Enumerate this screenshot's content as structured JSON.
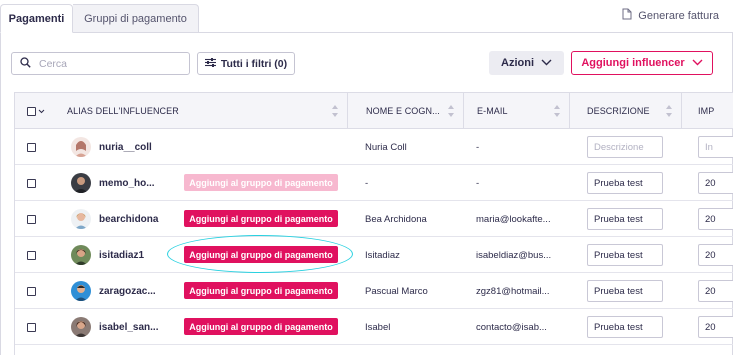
{
  "tabs": [
    {
      "label": "Pagamenti",
      "active": true
    },
    {
      "label": "Gruppi di pagamento",
      "active": false
    }
  ],
  "header_action": {
    "label": "Generare fattura",
    "icon": "document-icon"
  },
  "toolbar": {
    "search_placeholder": "Cerca",
    "search_icon": "search-icon",
    "filters_label": "Tutti i filtri (0)",
    "filters_icon": "sliders-icon",
    "actions_label": "Azioni",
    "add_influencer_label": "Aggiungi influencer"
  },
  "table": {
    "columns": [
      {
        "label": "ALIAS DELL'INFLUENCER"
      },
      {
        "label": "NOME E COGN..."
      },
      {
        "label": "E-MAIL"
      },
      {
        "label": "DESCRIZIONE"
      },
      {
        "label": "IMP"
      }
    ],
    "rows": [
      {
        "alias": "nuria__coll",
        "group_button": "",
        "name": "Nuria Coll",
        "email": "-",
        "description": "Descrizione",
        "description_is_placeholder": true,
        "amount": "In",
        "amount_is_placeholder": true
      },
      {
        "alias": "memo_ho...",
        "group_button": "Aggiungi al gruppo di pagamento",
        "group_button_disabled": true,
        "name": "-",
        "email": "-",
        "description": "Prueba test",
        "description_is_placeholder": false,
        "amount": "20",
        "amount_is_placeholder": false
      },
      {
        "alias": "bearchidona",
        "group_button": "Aggiungi al gruppo di pagamento",
        "group_button_disabled": false,
        "name": "Bea Archidona",
        "email": "maria@lookafte...",
        "description": "Prueba test",
        "description_is_placeholder": false,
        "amount": "20",
        "amount_is_placeholder": false
      },
      {
        "alias": "isitadiaz1",
        "group_button": "Aggiungi al gruppo di pagamento",
        "group_button_disabled": false,
        "name": "Isitadiaz",
        "email": "isabeldiaz@bus...",
        "description": "Prueba test",
        "description_is_placeholder": false,
        "amount": "20",
        "amount_is_placeholder": false
      },
      {
        "alias": "zaragozac...",
        "group_button": "Aggiungi al gruppo di pagamento",
        "group_button_disabled": false,
        "name": "Pascual Marco",
        "email": "zgz81@hotmail...",
        "description": "Prueba test",
        "description_is_placeholder": false,
        "amount": "20",
        "amount_is_placeholder": false
      },
      {
        "alias": "isabel_san...",
        "group_button": "Aggiungi al gruppo di pagamento",
        "group_button_disabled": false,
        "name": "Isabel",
        "email": "contacto@isab...",
        "description": "Prueba test",
        "description_is_placeholder": false,
        "amount": "20",
        "amount_is_placeholder": false
      }
    ]
  },
  "colors": {
    "accent": "#e0115f",
    "accent_faded": "#f7b8cf",
    "highlight": "#2ad1e0",
    "text": "#2d2b4a"
  }
}
